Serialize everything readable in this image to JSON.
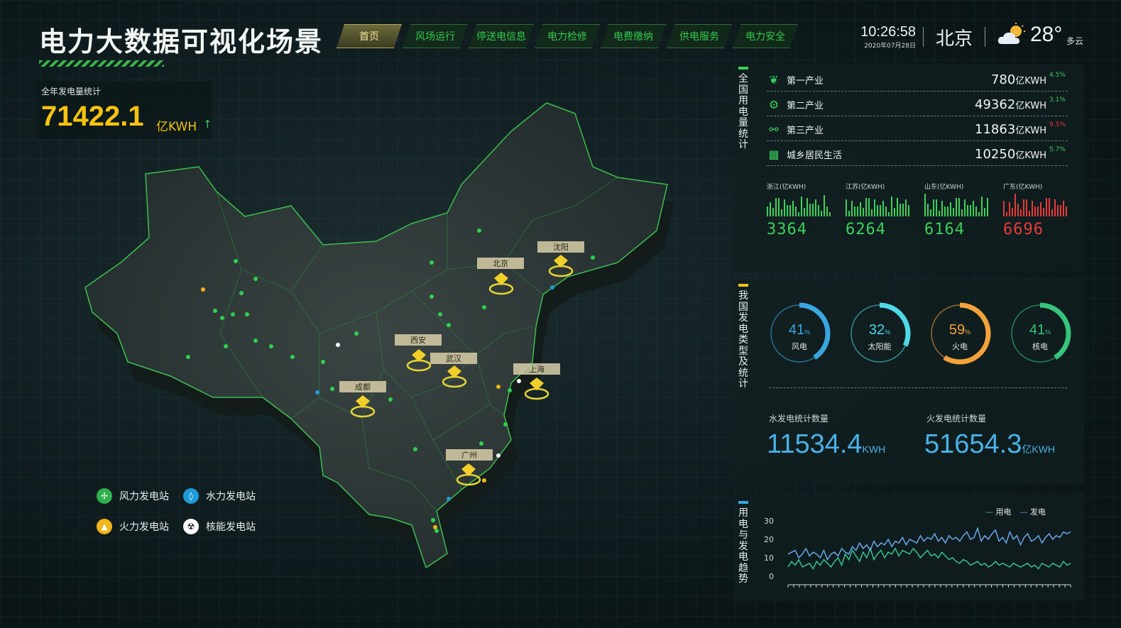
{
  "header": {
    "title": "电力大数据可视化场景",
    "nav": [
      "首页",
      "风场运行",
      "停送电信息",
      "电力检修",
      "电费缴纳",
      "供电服务",
      "电力安全"
    ],
    "active_nav": 0,
    "time": "10:26:58",
    "date": "2020年07月28日",
    "city": "北京",
    "temperature": "28°",
    "weather": "多云",
    "weather_icon": "partly-cloudy-icon"
  },
  "annual": {
    "label": "全年发电量统计",
    "value": "71422.1",
    "unit": "亿KWH",
    "arrow": "↑"
  },
  "map": {
    "cities": [
      "北京",
      "沈阳",
      "西安",
      "武汉",
      "上海",
      "成都",
      "广州"
    ]
  },
  "legend": [
    {
      "label": "风力发电站",
      "icon": "wind-turbine-icon",
      "color": "#2fb24c"
    },
    {
      "label": "水力发电站",
      "icon": "water-drop-icon",
      "color": "#1f9bd8"
    },
    {
      "label": "火力发电站",
      "icon": "flame-icon",
      "color": "#f0b51a"
    },
    {
      "label": "核能发电站",
      "icon": "nuclear-icon",
      "color": "#ffffff"
    }
  ],
  "consumption": {
    "title": "全国用电量统计",
    "rows": [
      {
        "name": "第一产业",
        "value": "780",
        "unit": "亿KWH",
        "pct": "4.5%",
        "pct_color": "#3cd05a",
        "icon": "leaf-icon"
      },
      {
        "name": "第二产业",
        "value": "49362",
        "unit": "亿KWH",
        "pct": "3.1%",
        "pct_color": "#3cd05a",
        "icon": "gear-icon"
      },
      {
        "name": "第三产业",
        "value": "11863",
        "unit": "亿KWH",
        "pct": "9.5%",
        "pct_color": "#e83a3a",
        "icon": "services-icon"
      },
      {
        "name": "城乡居民生活",
        "value": "10250",
        "unit": "亿KWH",
        "pct": "5.7%",
        "pct_color": "#3cd05a",
        "icon": "building-icon"
      }
    ],
    "provinces": [
      {
        "label": "浙江(亿KWH)",
        "value": "3364",
        "color": "#3cd05a"
      },
      {
        "label": "江苏(亿KWH)",
        "value": "6264",
        "color": "#3cd05a"
      },
      {
        "label": "山东(亿KWH)",
        "value": "6164",
        "color": "#3cd05a"
      },
      {
        "label": "广东(亿KWH)",
        "value": "6696",
        "color": "#e83a3a"
      }
    ]
  },
  "generation": {
    "title": "我国发电类型及统计",
    "gauges": [
      {
        "value": 41,
        "unit": "%",
        "label": "风电",
        "color": "#3aa6e0"
      },
      {
        "value": 32,
        "unit": "%",
        "label": "太阳能",
        "color": "#4fd8e6"
      },
      {
        "value": 59,
        "unit": "%",
        "label": "火电",
        "color": "#f3a23a"
      },
      {
        "value": 41,
        "unit": "%",
        "label": "核电",
        "color": "#35c47a"
      }
    ],
    "hydro": {
      "label": "水发电统计数量",
      "value": "11534.4",
      "unit": "KWH"
    },
    "thermal": {
      "label": "火发电统计数量",
      "value": "51654.3",
      "unit": "亿KWH"
    }
  },
  "trend": {
    "title": "用电与发电趋势",
    "legend": [
      {
        "name": "用电",
        "color": "#35c48e"
      },
      {
        "name": "发电",
        "color": "#6aa8e8"
      }
    ]
  },
  "chart_data": {
    "type": "line",
    "ylim": [
      0,
      30
    ],
    "yticks": [
      "0",
      "10",
      "20",
      "30"
    ],
    "series": [
      {
        "name": "用电",
        "values": [
          5,
          8,
          6,
          9,
          5,
          6,
          7,
          4,
          8,
          6,
          9,
          7,
          5,
          8,
          10,
          6,
          12,
          9,
          14,
          11,
          8,
          13,
          10,
          15,
          9,
          12,
          14,
          10,
          13,
          12,
          15,
          11,
          14,
          13,
          12,
          15,
          13,
          10,
          12,
          14,
          11,
          12,
          10,
          13,
          11,
          9,
          10,
          8,
          7,
          9,
          8,
          6,
          7,
          8,
          6,
          7,
          5,
          6,
          8,
          6,
          7,
          6,
          5,
          7,
          6,
          5,
          6,
          7,
          5,
          6,
          4,
          7,
          6,
          5,
          7,
          6,
          5,
          8,
          6,
          7
        ]
      },
      {
        "name": "发电",
        "values": [
          12,
          13,
          14,
          10,
          12,
          15,
          11,
          13,
          12,
          10,
          14,
          9,
          12,
          13,
          11,
          15,
          13,
          12,
          16,
          14,
          18,
          15,
          17,
          14,
          19,
          16,
          18,
          17,
          20,
          16,
          19,
          18,
          21,
          17,
          20,
          19,
          18,
          22,
          19,
          21,
          20,
          23,
          19,
          21,
          18,
          22,
          20,
          21,
          19,
          22,
          24,
          20,
          21,
          26,
          19,
          22,
          20,
          23,
          25,
          19,
          21,
          18,
          24,
          20,
          22,
          17,
          21,
          23,
          19,
          20,
          22,
          18,
          21,
          23,
          20,
          22,
          21,
          24,
          23,
          24
        ]
      }
    ]
  }
}
